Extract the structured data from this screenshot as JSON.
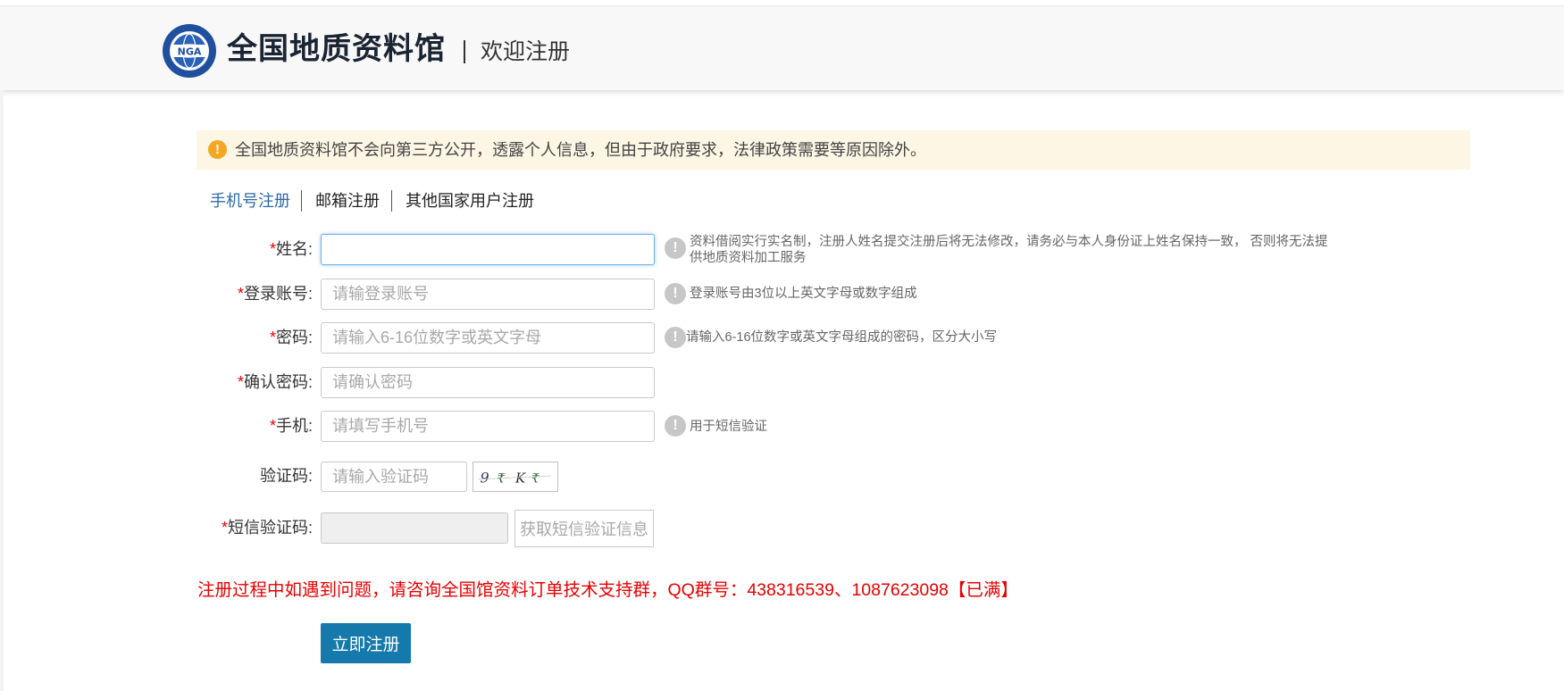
{
  "header": {
    "logo_text": "NGA",
    "site_name": "全国地质资料馆",
    "subtitle": "欢迎注册"
  },
  "notice": {
    "icon": "warning-circle-icon",
    "text": "全国地质资料馆不会向第三方公开，透露个人信息，但由于政府要求，法律政策需要等原因除外。"
  },
  "tabs": [
    {
      "label": "手机号注册",
      "active": true
    },
    {
      "label": "邮箱注册",
      "active": false
    },
    {
      "label": "其他国家用户注册",
      "active": false
    }
  ],
  "form": {
    "name": {
      "required": "*",
      "label": "姓名:",
      "value": "",
      "placeholder": "",
      "hint_line1": "资料借阅实行实名制，注册人姓名提交注册后将无法修改，请务必与本人身份证上姓名保持一致， 否则将无法提",
      "hint_line2": "供地质资料加工服务"
    },
    "account": {
      "required": "*",
      "label": "登录账号:",
      "placeholder": "请输登录账号",
      "hint": "登录账号由3位以上英文字母或数字组成"
    },
    "password": {
      "required": "*",
      "label": "密码:",
      "placeholder": "请输入6-16位数字或英文字母",
      "hint": "请输入6-16位数字或英文字母组成的密码，区分大小写"
    },
    "confirm_password": {
      "required": "*",
      "label": "确认密码:",
      "placeholder": "请确认密码"
    },
    "phone": {
      "required": "*",
      "label": "手机:",
      "placeholder": "请填写手机号",
      "hint": "用于短信验证"
    },
    "captcha": {
      "label": "验证码:",
      "placeholder": "请输入验证码",
      "image_chars": "9 ? K ?"
    },
    "sms_code": {
      "required": "*",
      "label": "短信验证码:",
      "button_label": "获取短信验证信息"
    }
  },
  "help_text": "注册过程中如遇到问题，请咨询全国馆资料订单技术支持群，QQ群号：438316539、1087623098【已满】",
  "submit_label": "立即注册",
  "colors": {
    "accent": "#1679ab",
    "tab_active": "#2c6aa8",
    "required": "#ee0000",
    "help_text": "#e60000",
    "notice_bg": "#fdf6e4",
    "notice_icon": "#f5a623"
  }
}
